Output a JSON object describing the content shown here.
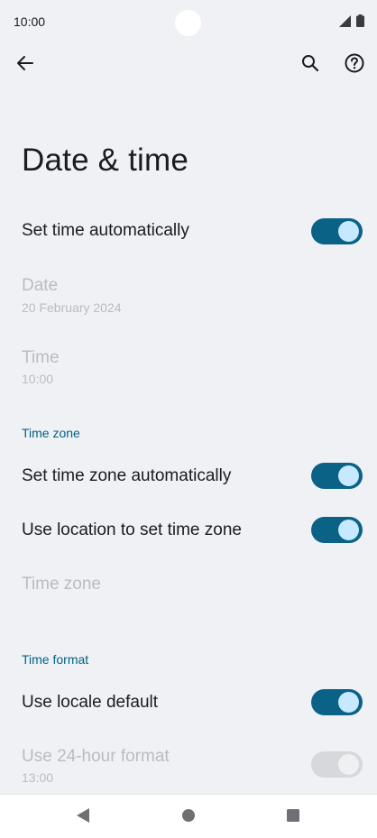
{
  "status_bar": {
    "time": "10:00"
  },
  "icons": {
    "back": "arrow-left-icon",
    "search": "search-icon",
    "help": "help-circle-icon",
    "signal": "signal-icon",
    "battery": "battery-icon"
  },
  "page": {
    "title": "Date & time"
  },
  "settings": {
    "set_time_auto": {
      "label": "Set time automatically",
      "checked": true
    },
    "date": {
      "label": "Date",
      "value": "20 February 2024"
    },
    "time": {
      "label": "Time",
      "value": "10:00"
    },
    "time_zone_header": "Time zone",
    "set_tz_auto": {
      "label": "Set time zone automatically",
      "checked": true
    },
    "use_location_tz": {
      "label": "Use location to set time zone",
      "checked": true
    },
    "time_zone": {
      "label": "Time zone"
    },
    "time_format_header": "Time format",
    "locale_default": {
      "label": "Use locale default",
      "checked": true
    },
    "format_24h": {
      "label": "Use 24-hour format",
      "value": "13:00",
      "checked": true
    }
  },
  "colors": {
    "accent": "#0a6286",
    "thumb": "#c6e9ff",
    "section_header": "#006285",
    "disabled_text": "#b9bcc2",
    "background": "#f0f1f5"
  }
}
